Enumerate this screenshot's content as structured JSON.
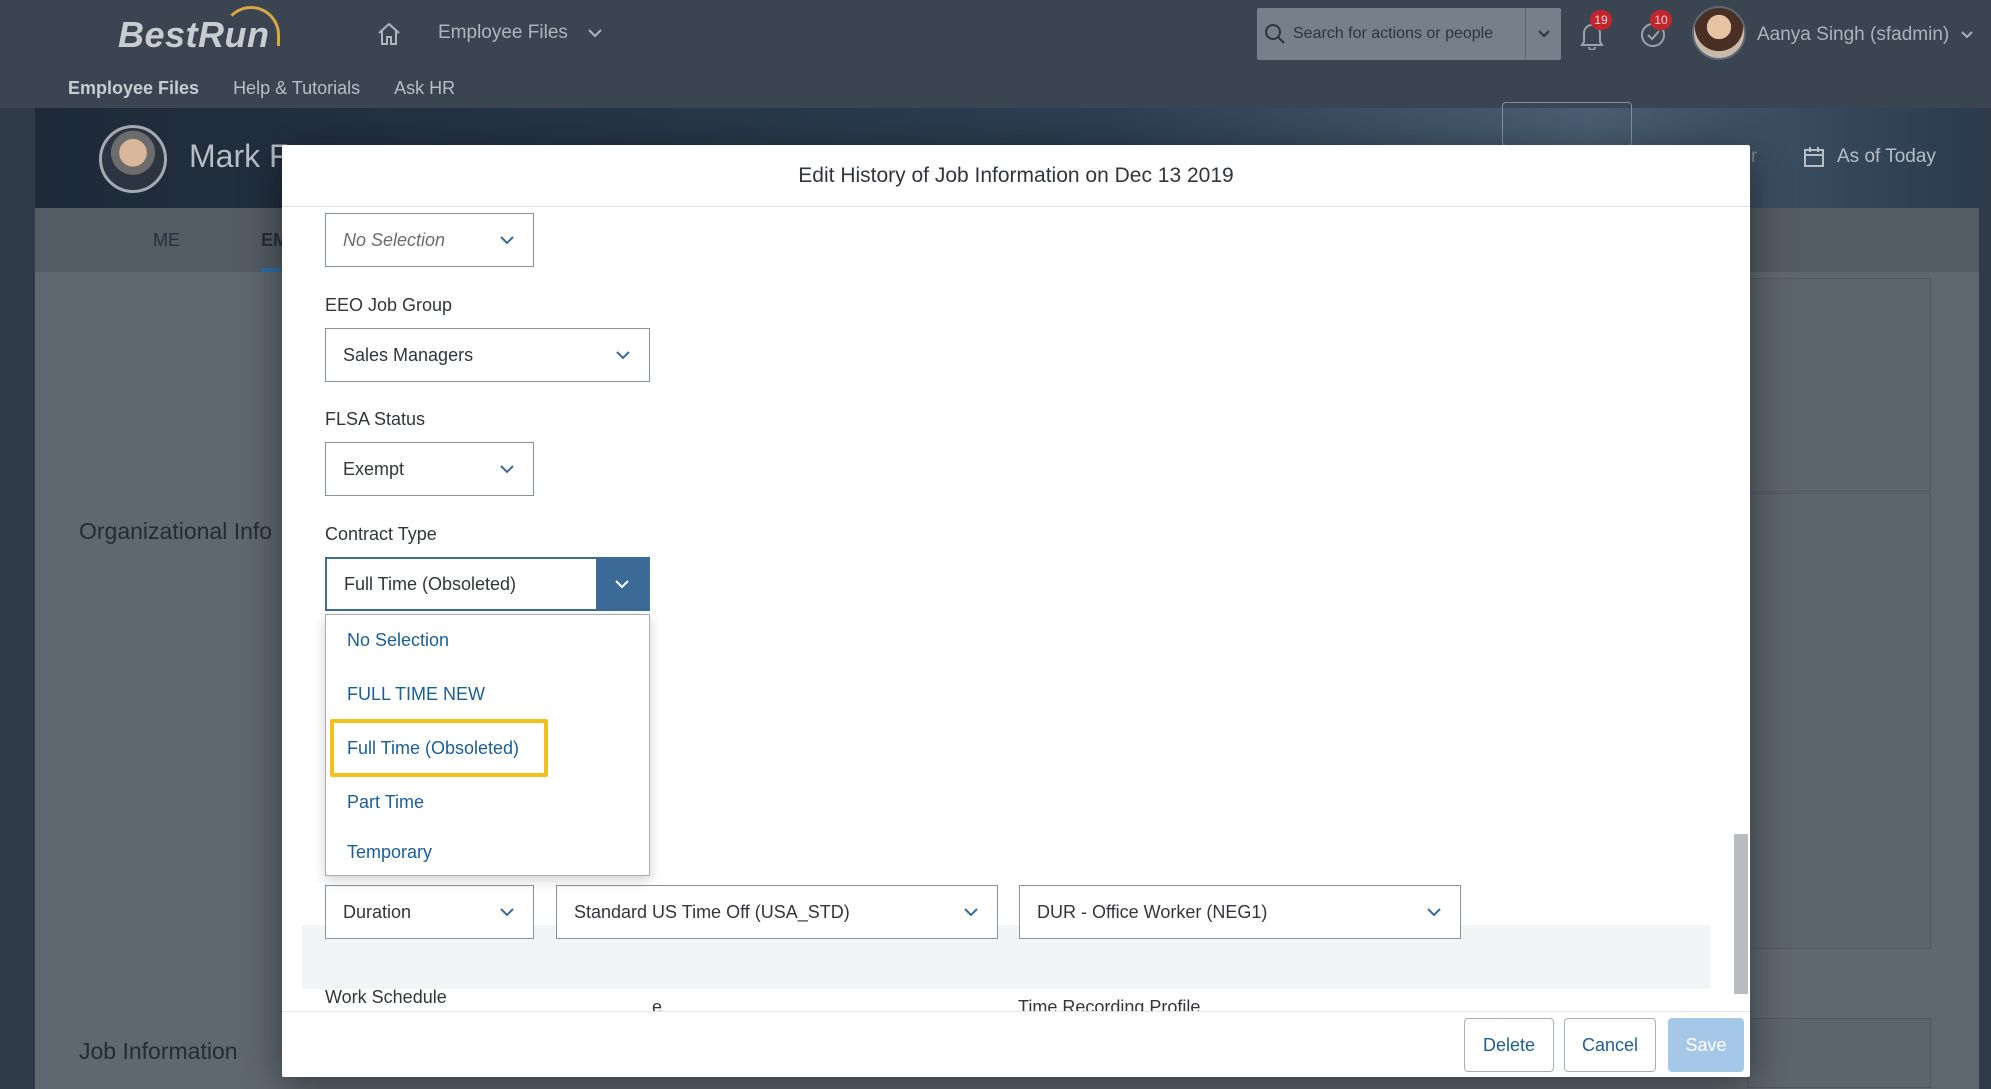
{
  "shell": {
    "logo": "BestRun",
    "app_title": "Employee Files",
    "search_placeholder": "Search for actions or people",
    "notifications_count": "19",
    "todo_count": "10",
    "user_name": "Aanya Singh (sfadmin)",
    "subnav": [
      "Employee Files",
      "Help & Tutorials",
      "Ask HR"
    ]
  },
  "background": {
    "employee_name": "Mark F",
    "as_of": "As of Today",
    "partial_text": "r",
    "tabs": [
      "ME",
      "EM"
    ],
    "sections": [
      "Organizational Info",
      "Job Information"
    ]
  },
  "dialog": {
    "title": "Edit History of Job Information on Dec 13 2019",
    "fields": {
      "top_select_value": "No Selection",
      "eeo_label": "EEO Job Group",
      "eeo_value": "Sales Managers",
      "flsa_label": "FLSA Status",
      "flsa_value": "Exempt",
      "contract_label": "Contract Type",
      "contract_value": "Full Time (Obsoleted)",
      "time_type_label_partial": "e",
      "time_recording_label": "Time Recording Profile",
      "duration_value": "Duration",
      "time_off_value": "Standard US Time Off (USA_STD)",
      "time_recording_value": "DUR - Office Worker (NEG1)",
      "work_schedule_label": "Work Schedule"
    },
    "contract_options": [
      "No Selection",
      "FULL TIME NEW",
      "Full Time (Obsoleted)",
      "Part Time",
      "Temporary"
    ],
    "highlighted_option": "Full Time (Obsoleted)",
    "buttons": {
      "delete": "Delete",
      "cancel": "Cancel",
      "save": "Save"
    }
  },
  "colors": {
    "accent": "#3a6a95",
    "highlight": "#f2c21a",
    "link": "#1a5e9a",
    "badge": "#c1262e"
  }
}
